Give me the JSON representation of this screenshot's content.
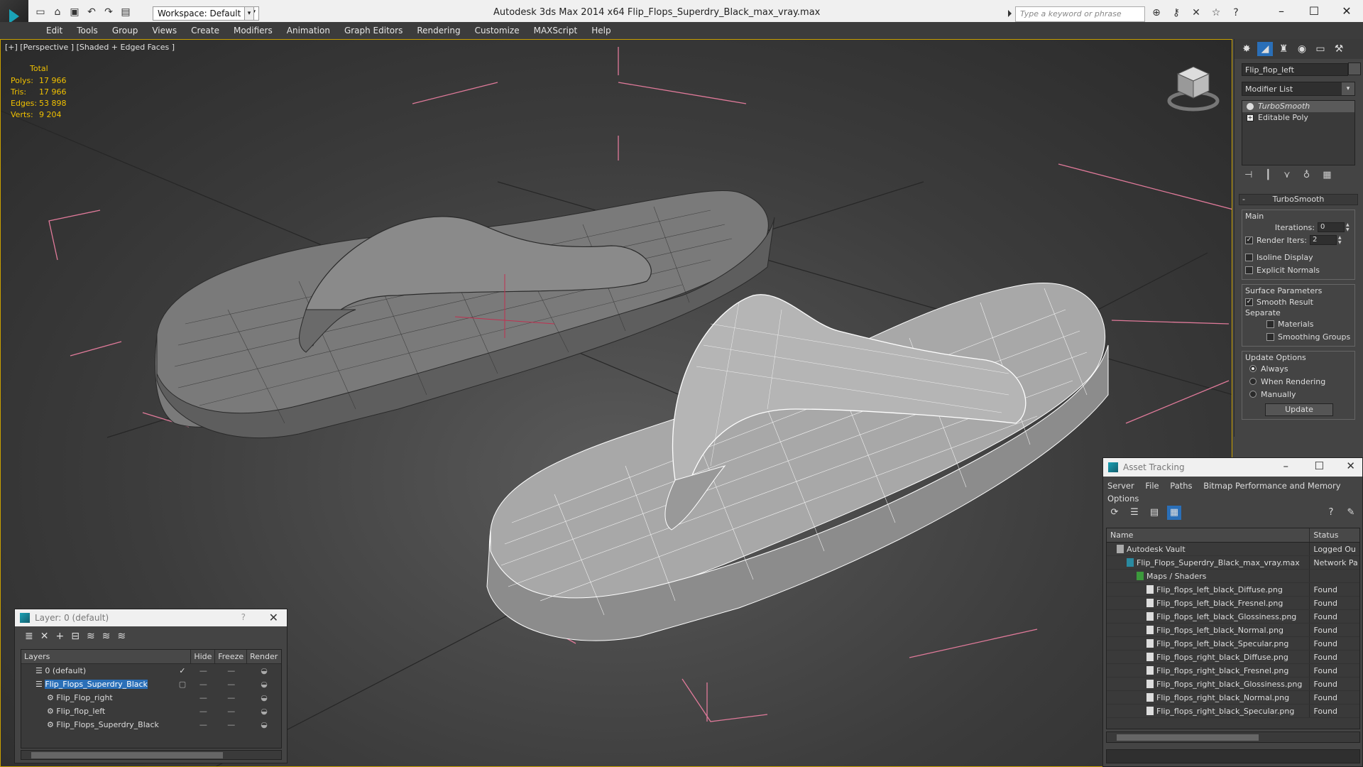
{
  "app": {
    "title": "Autodesk 3ds Max  2014 x64     Flip_Flops_Superdry_Black_max_vray.max",
    "workspace": "Workspace: Default",
    "search_placeholder": "Type a keyword or phrase"
  },
  "menu": [
    "Edit",
    "Tools",
    "Group",
    "Views",
    "Create",
    "Modifiers",
    "Animation",
    "Graph Editors",
    "Rendering",
    "Customize",
    "MAXScript",
    "Help"
  ],
  "viewport": {
    "label": "[+] [Perspective ] [Shaded + Edged Faces ]",
    "stats_total": "Total",
    "stats": [
      {
        "k": "Polys:",
        "v": "17 966"
      },
      {
        "k": "Tris:",
        "v": "17 966"
      },
      {
        "k": "Edges:",
        "v": "53 898"
      },
      {
        "k": "Verts:",
        "v": "9 204"
      }
    ]
  },
  "command_panel": {
    "object_name": "Flip_flop_left",
    "modifier_list": "Modifier List",
    "stack": [
      "TurboSmooth",
      "Editable Poly"
    ],
    "rollout": "TurboSmooth",
    "main_label": "Main",
    "iterations_label": "Iterations:",
    "iterations_value": "0",
    "render_iters_label": "Render Iters:",
    "render_iters_value": "2",
    "isoline_label": "Isoline Display",
    "explicit_label": "Explicit Normals",
    "surface_label": "Surface Parameters",
    "smooth_label": "Smooth Result",
    "separate_label": "Separate",
    "materials_label": "Materials",
    "smoothing_groups_label": "Smoothing Groups",
    "update_options_label": "Update Options",
    "always_label": "Always",
    "when_rendering_label": "When Rendering",
    "manually_label": "Manually",
    "update_button": "Update"
  },
  "layer_dialog": {
    "title": "Layer: 0 (default)",
    "help": "?",
    "columns": [
      "Layers",
      "Hide",
      "Freeze",
      "Render"
    ],
    "rows": [
      {
        "name": "0 (default)",
        "indent": 0,
        "selected": false,
        "check": "✓"
      },
      {
        "name": "Flip_Flops_Superdry_Black",
        "indent": 0,
        "selected": true,
        "check": ""
      },
      {
        "name": "Flip_Flop_right",
        "indent": 1,
        "selected": false,
        "check": ""
      },
      {
        "name": "Flip_flop_left",
        "indent": 1,
        "selected": false,
        "check": ""
      },
      {
        "name": "Flip_Flops_Superdry_Black",
        "indent": 1,
        "selected": false,
        "check": ""
      }
    ]
  },
  "asset_dialog": {
    "title": "Asset Tracking",
    "menu": [
      "Server",
      "File",
      "Paths",
      "Bitmap Performance and Memory",
      "Options"
    ],
    "columns": [
      "Name",
      "Status"
    ],
    "rows": [
      {
        "name": "Autodesk Vault",
        "status": "Logged Ou",
        "indent": 1
      },
      {
        "name": "Flip_Flops_Superdry_Black_max_vray.max",
        "status": "Network Pa",
        "indent": 2
      },
      {
        "name": "Maps / Shaders",
        "status": "",
        "indent": 3
      },
      {
        "name": "Flip_flops_left_black_Diffuse.png",
        "status": "Found",
        "indent": 4
      },
      {
        "name": "Flip_flops_left_black_Fresnel.png",
        "status": "Found",
        "indent": 4
      },
      {
        "name": "Flip_flops_left_black_Glossiness.png",
        "status": "Found",
        "indent": 4
      },
      {
        "name": "Flip_flops_left_black_Normal.png",
        "status": "Found",
        "indent": 4
      },
      {
        "name": "Flip_flops_left_black_Specular.png",
        "status": "Found",
        "indent": 4
      },
      {
        "name": "Flip_flops_right_black_Diffuse.png",
        "status": "Found",
        "indent": 4
      },
      {
        "name": "Flip_flops_right_black_Fresnel.png",
        "status": "Found",
        "indent": 4
      },
      {
        "name": "Flip_flops_right_black_Glossiness.png",
        "status": "Found",
        "indent": 4
      },
      {
        "name": "Flip_flops_right_black_Normal.png",
        "status": "Found",
        "indent": 4
      },
      {
        "name": "Flip_flops_right_black_Specular.png",
        "status": "Found",
        "indent": 4
      }
    ]
  }
}
